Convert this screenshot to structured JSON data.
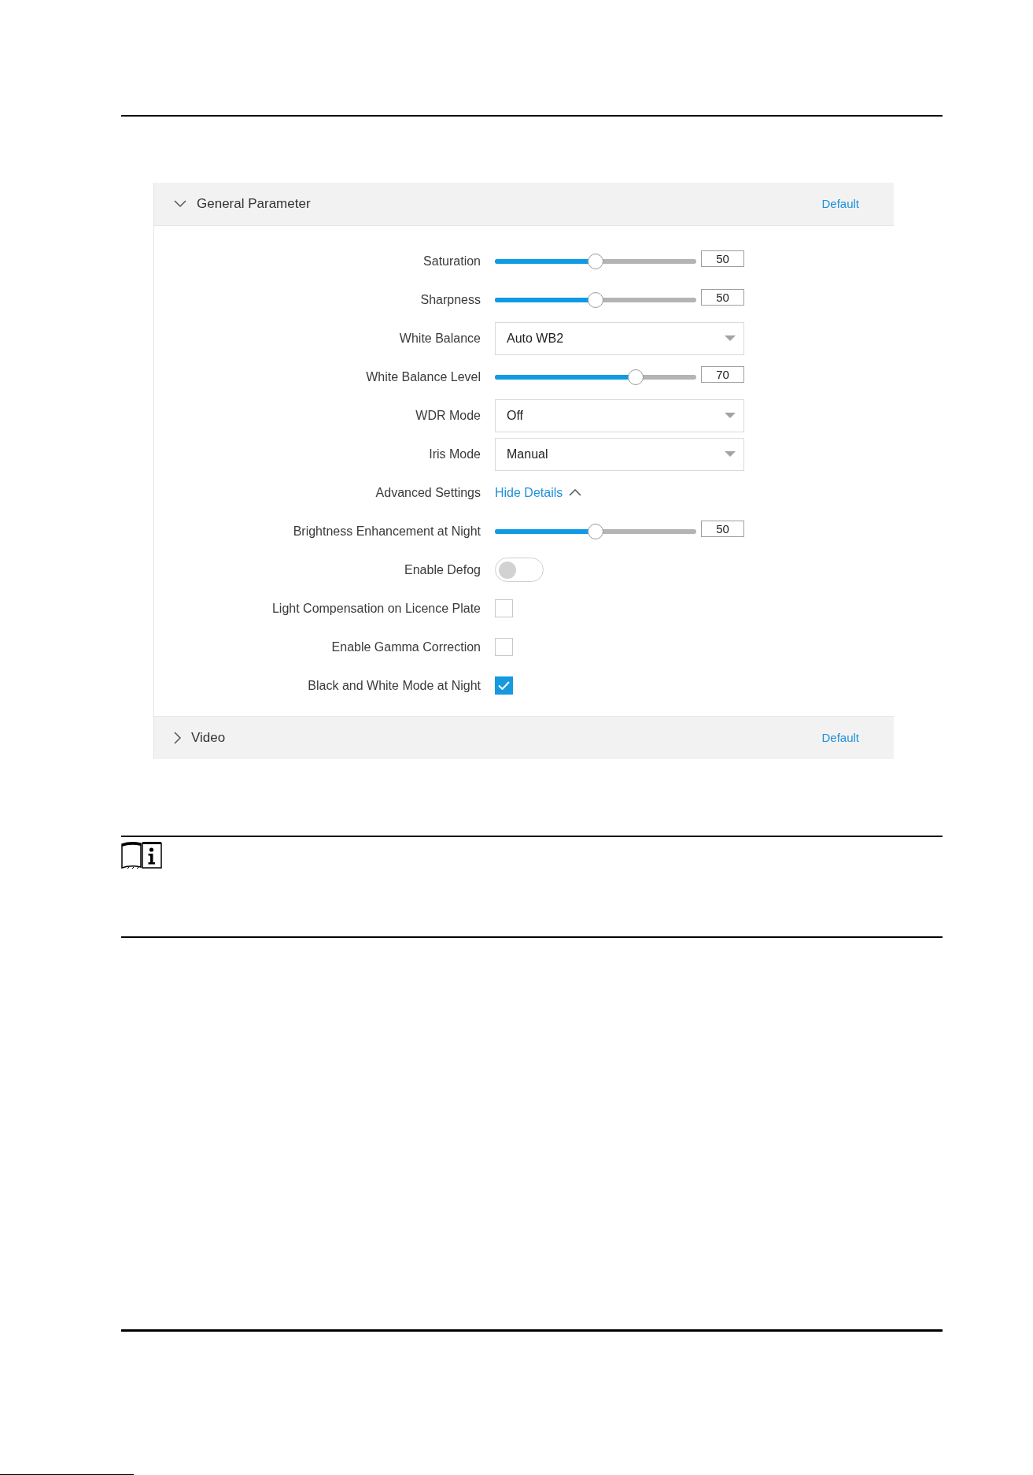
{
  "panels": [
    {
      "title": "General Parameter",
      "expanded": true,
      "action": "Default",
      "rows": [
        {
          "kind": "slider",
          "label": "Saturation",
          "level": 0.5,
          "value": "50"
        },
        {
          "kind": "slider",
          "label": "Sharpness",
          "level": 0.5,
          "value": "50"
        },
        {
          "kind": "select",
          "label": "White Balance",
          "value": "Auto WB2"
        },
        {
          "kind": "slider",
          "label": "White Balance Level",
          "level": 0.7,
          "value": "70"
        },
        {
          "kind": "select",
          "label": "WDR Mode",
          "value": "Off"
        },
        {
          "kind": "select",
          "label": "Iris Mode",
          "value": "Manual"
        },
        {
          "kind": "link",
          "label": "Advanced Settings",
          "link": "Hide Details",
          "expanded": true
        },
        {
          "kind": "slider",
          "label": "Brightness Enhancement at Night",
          "level": 0.5,
          "value": "50"
        },
        {
          "kind": "toggle",
          "label": "Enable Defog",
          "on": false
        },
        {
          "kind": "checkbox",
          "label": "Light Compensation on Licence Plate",
          "checked": false
        },
        {
          "kind": "checkbox",
          "label": "Enable Gamma Correction",
          "checked": false
        },
        {
          "kind": "checkbox",
          "label": "Black and White Mode at Night",
          "checked": true
        }
      ]
    },
    {
      "title": "Video",
      "expanded": false,
      "action": "Default"
    }
  ]
}
